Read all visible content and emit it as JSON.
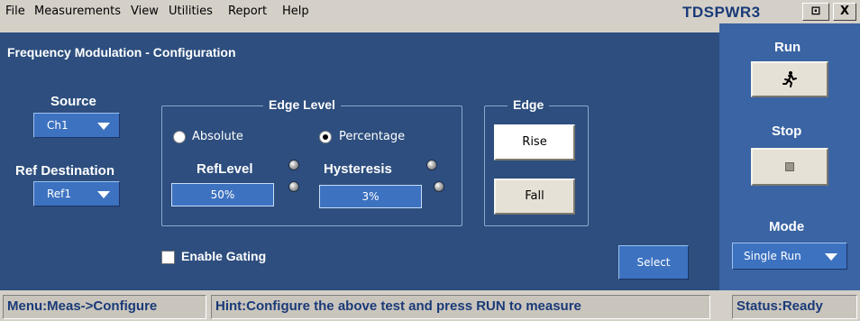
{
  "menu": {
    "items": [
      "File",
      "Measurements",
      "View",
      "Utilities",
      "Report",
      "Help"
    ],
    "app_title": "TDSPWR3",
    "title_buttons": [
      "⊡",
      "X"
    ]
  },
  "main": {
    "title": "Frequency Modulation - Configuration",
    "source": {
      "label": "Source",
      "value": "Ch1"
    },
    "ref_destination": {
      "label": "Ref Destination",
      "value": "Ref1"
    },
    "edge_level": {
      "title": "Edge Level",
      "mode_options": [
        "Absolute",
        "Percentage"
      ],
      "selected_mode": "Percentage",
      "reflevel": {
        "label": "RefLevel",
        "value": "50%"
      },
      "hysteresis": {
        "label": "Hysteresis",
        "value": "3%"
      }
    },
    "edge": {
      "title": "Edge",
      "rise_label": "Rise",
      "fall_label": "Fall"
    },
    "enable_gating": {
      "label": "Enable Gating",
      "checked": false
    },
    "select_label": "Select"
  },
  "right_panel": {
    "run_label": "Run",
    "stop_label": "Stop",
    "mode_label": "Mode",
    "mode_value": "Single Run"
  },
  "status": {
    "menu": "Menu:Meas->Configure",
    "hint": "Hint:Configure the above test and press RUN to measure",
    "status": "Status:Ready"
  },
  "colors": {
    "main_panel": "#2d4e7e",
    "right_panel": "#3a64a3",
    "control_blue": "#3d72c0",
    "status_text": "#1a3a78"
  }
}
